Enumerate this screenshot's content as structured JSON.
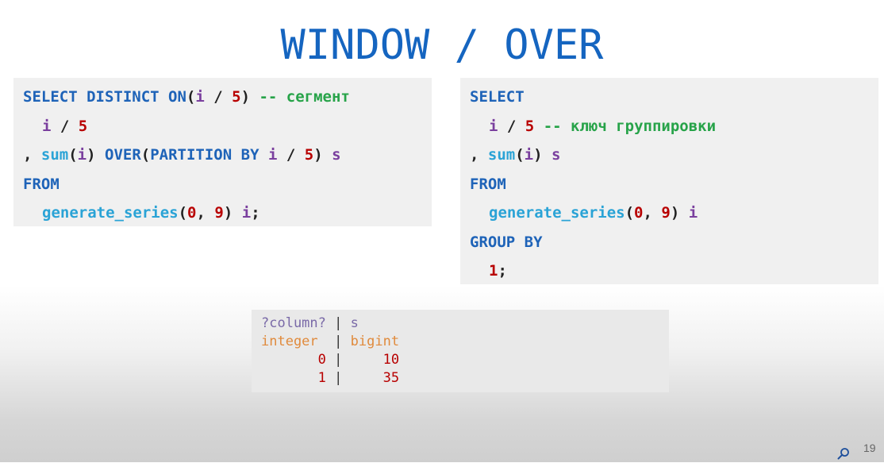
{
  "slide": {
    "title": "WINDOW / OVER",
    "page_number": "19"
  },
  "left_query": {
    "lines": [
      [
        "SELECT DISTINCT ON",
        "(",
        "i",
        " / ",
        "5",
        ") ",
        "-- сегмент"
      ],
      [
        "i",
        " / ",
        "5"
      ],
      [
        ", ",
        "sum",
        "(",
        "i",
        ") ",
        "OVER",
        "(",
        "PARTITION BY",
        " ",
        "i",
        " / ",
        "5",
        ") ",
        "s"
      ],
      [
        "FROM"
      ],
      [
        "generate_series",
        "(",
        "0",
        ", ",
        "9",
        ") ",
        "i",
        ";"
      ]
    ]
  },
  "right_query": {
    "lines": [
      [
        "SELECT"
      ],
      [
        "i",
        " / ",
        "5",
        " ",
        "-- ключ группировки"
      ],
      [
        ", ",
        "sum",
        "(",
        "i",
        ") ",
        "s"
      ],
      [
        "FROM"
      ],
      [
        "generate_series",
        "(",
        "0",
        ", ",
        "9",
        ") ",
        "i"
      ],
      [
        "GROUP BY"
      ],
      [
        "1",
        ";"
      ]
    ]
  },
  "result": {
    "col1_name": "?column?",
    "col2_name": "s",
    "col1_type": "integer",
    "col2_type": "bigint",
    "separator": "|",
    "rows": [
      [
        "0",
        "10"
      ],
      [
        "1",
        "35"
      ]
    ]
  },
  "icons": {
    "search": "search-icon"
  }
}
